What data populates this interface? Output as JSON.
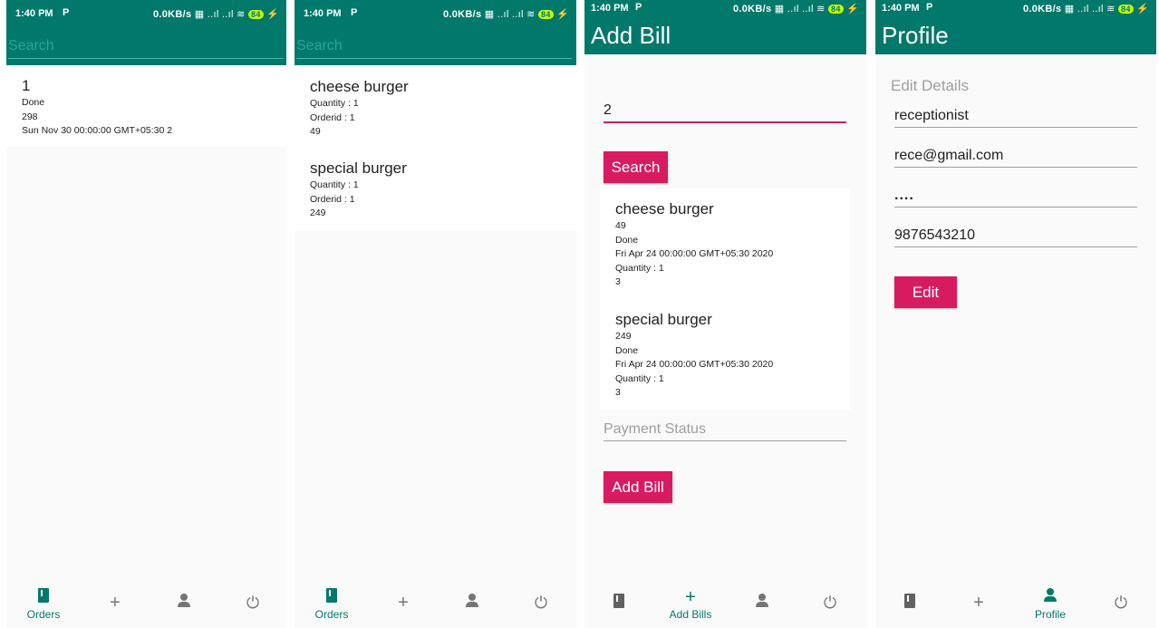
{
  "status": {
    "time": "1:40 PM",
    "carrier_glyph": "P",
    "network": "0.0KB/s",
    "battery": "84"
  },
  "screen1": {
    "search_placeholder": "Search",
    "orders": [
      {
        "title": "1",
        "lines": [
          "Done",
          "298",
          "Sun Nov 30 00:00:00 GMT+05:30 2"
        ]
      }
    ]
  },
  "screen2": {
    "search_placeholder": "Search",
    "items": [
      {
        "title": "cheese burger",
        "lines": [
          "Quantity : 1",
          "Orderid : 1",
          "49"
        ]
      },
      {
        "title": "special burger",
        "lines": [
          "Quantity : 1",
          "Orderid : 1",
          "249"
        ]
      }
    ]
  },
  "screen3": {
    "title": "Add Bill",
    "order_id_value": "2",
    "search_button": "Search",
    "results": [
      {
        "title": "cheese burger",
        "lines": [
          "49",
          "Done",
          "Fri Apr 24 00:00:00 GMT+05:30 2020",
          "Quantity : 1",
          "3"
        ]
      },
      {
        "title": "special burger",
        "lines": [
          "249",
          "Done",
          "Fri Apr 24 00:00:00 GMT+05:30 2020",
          "Quantity : 1",
          "3"
        ]
      }
    ],
    "payment_placeholder": "Payment Status",
    "add_bill_button": "Add Bill"
  },
  "screen4": {
    "title": "Profile",
    "section": "Edit Details",
    "name": "receptionist",
    "email": "rece@gmail.com",
    "password": "....",
    "phone": "9876543210",
    "edit_button": "Edit"
  },
  "nav": {
    "orders": "Orders",
    "add_bills": "Add Bills",
    "profile": "Profile",
    "plus_glyph": "+",
    "power_glyph": "⏻"
  },
  "colors": {
    "primary": "#00796b",
    "accent": "#d81b60"
  }
}
